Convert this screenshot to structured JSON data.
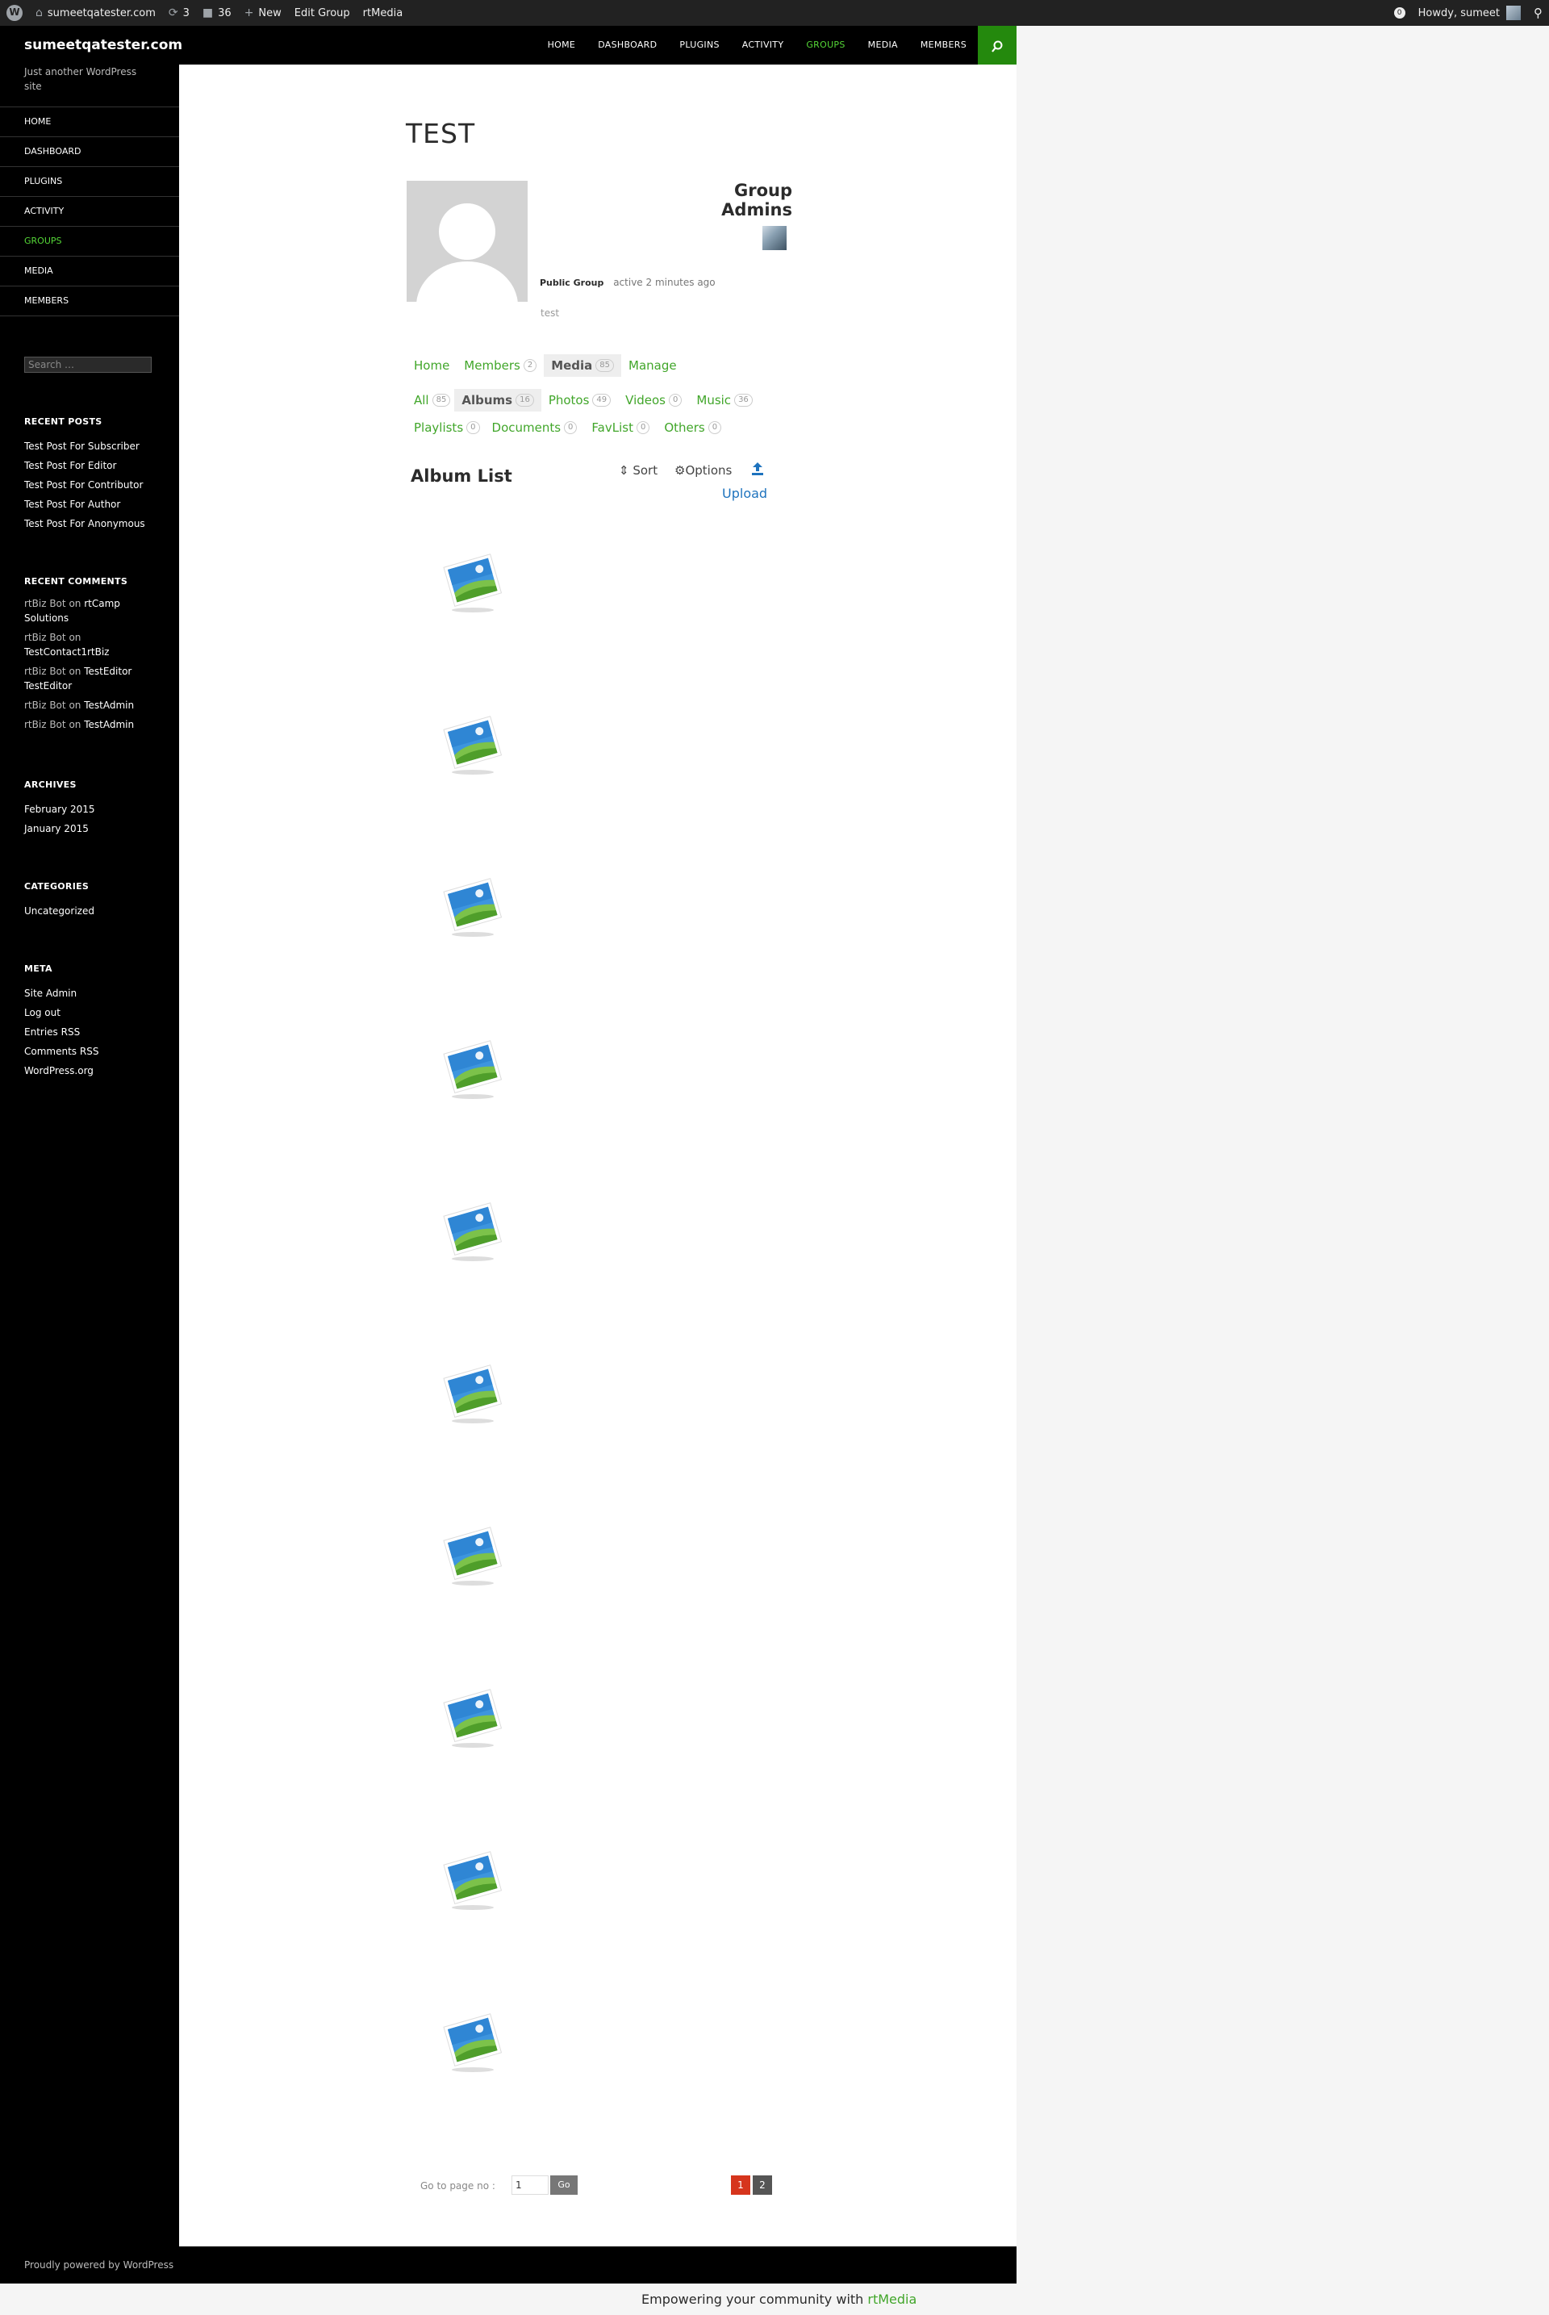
{
  "adminbar": {
    "site_name": "sumeetqatester.com",
    "updates_count": "3",
    "comments_count": "36",
    "new_label": "New",
    "edit_group_label": "Edit Group",
    "rtmedia_label": "rtMedia",
    "howdy_label": "Howdy, sumeet"
  },
  "header": {
    "site_title": "sumeetqatester.com",
    "nav": [
      "HOME",
      "DASHBOARD",
      "PLUGINS",
      "ACTIVITY",
      "GROUPS",
      "MEDIA",
      "MEMBERS"
    ],
    "active_nav": "GROUPS"
  },
  "sidebar": {
    "tagline": "Just another WordPress site",
    "nav": [
      "HOME",
      "DASHBOARD",
      "PLUGINS",
      "ACTIVITY",
      "GROUPS",
      "MEDIA",
      "MEMBERS"
    ],
    "search_placeholder": "Search …",
    "recent_posts": {
      "title": "RECENT POSTS",
      "items": [
        "Test Post For Subscriber",
        "Test Post For Editor",
        "Test Post For Contributor",
        "Test Post For Author",
        "Test Post For Anonymous"
      ]
    },
    "recent_comments": {
      "title": "RECENT COMMENTS",
      "items": [
        {
          "author": "rtBiz Bot",
          "on": "on",
          "post": "rtCamp Solutions"
        },
        {
          "author": "rtBiz Bot",
          "on": "on",
          "post": "TestContact1rtBiz"
        },
        {
          "author": "rtBiz Bot",
          "on": "on",
          "post": "TestEditor TestEditor"
        },
        {
          "author": "rtBiz Bot",
          "on": "on",
          "post": "TestAdmin"
        },
        {
          "author": "rtBiz Bot",
          "on": "on",
          "post": "TestAdmin"
        }
      ]
    },
    "archives": {
      "title": "ARCHIVES",
      "items": [
        "February 2015",
        "January 2015"
      ]
    },
    "categories": {
      "title": "CATEGORIES",
      "items": [
        "Uncategorized"
      ]
    },
    "meta": {
      "title": "META",
      "items": [
        "Site Admin",
        "Log out",
        "Entries RSS",
        "Comments RSS",
        "WordPress.org"
      ]
    }
  },
  "group": {
    "title": "TEST",
    "admins_heading": "Group Admins",
    "type": "Public Group",
    "activity": "active 2 minutes ago",
    "description": "test"
  },
  "group_tabs": [
    {
      "label": "Home",
      "count": null
    },
    {
      "label": "Members",
      "count": "2"
    },
    {
      "label": "Media",
      "count": "85",
      "current": true
    },
    {
      "label": "Manage",
      "count": null
    }
  ],
  "media_tabs_row1": [
    {
      "label": "All",
      "count": "85"
    },
    {
      "label": "Albums",
      "count": "16",
      "current": true
    },
    {
      "label": "Photos",
      "count": "49"
    },
    {
      "label": "Videos",
      "count": "0"
    },
    {
      "label": "Music",
      "count": "36"
    }
  ],
  "media_tabs_row2": [
    {
      "label": "Playlists",
      "count": "0"
    },
    {
      "label": "Documents",
      "count": "0"
    },
    {
      "label": "FavList",
      "count": "0"
    },
    {
      "label": "Others",
      "count": "0"
    }
  ],
  "album_list": {
    "heading": "Album List",
    "sort_label": "Sort",
    "options_label": "Options",
    "upload_label": "Upload",
    "album_count_shown": 10
  },
  "pagination": {
    "goto_label": "Go to page no :",
    "goto_value": "1",
    "go_label": "Go",
    "pages": [
      "1",
      "2"
    ],
    "current": "1"
  },
  "footer": {
    "powered_by": "Proudly powered by WordPress",
    "rtmedia_credit_prefix": "Empowering your community with",
    "rtmedia_credit_link": "rtMedia"
  },
  "colors": {
    "accent_green": "#41a62a",
    "active_nav_green": "#55d737",
    "search_toggle_bg": "#24890d",
    "upload_blue": "#1e73be",
    "current_page_red": "#d6351d"
  }
}
